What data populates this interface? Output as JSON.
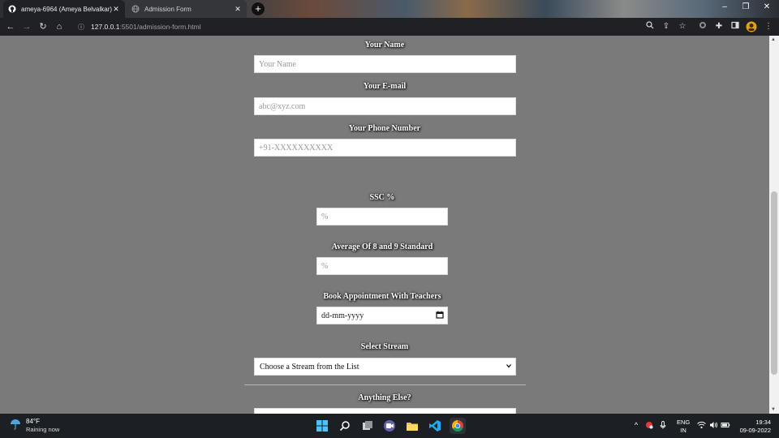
{
  "browser": {
    "tabs": [
      {
        "title": "ameya-6964 (Ameya Belvalkar)",
        "active": true
      },
      {
        "title": "Admission Form",
        "active": false
      }
    ],
    "url_host": "127.0.0.1",
    "url_path": ":5501/admission-form.html"
  },
  "form": {
    "name_label": "Your Name",
    "name_placeholder": "Your Name",
    "email_label": "Your E-mail",
    "email_placeholder": "abc@xyz.com",
    "phone_label": "Your Phone Number",
    "phone_placeholder": "+91-XXXXXXXXXX",
    "ssc_label": "SSC %",
    "ssc_placeholder": "%",
    "avg_label": "Average Of 8 and 9 Standard",
    "avg_placeholder": "%",
    "appointment_label": "Book Appointment With Teachers",
    "appointment_value": "dd-mm-yyyy",
    "stream_label": "Select Stream",
    "stream_selected": "Choose a Stream from the List",
    "anything_label": "Anything Else?"
  },
  "taskbar": {
    "temperature": "84°F",
    "weather": "Raining now",
    "lang_top": "ENG",
    "lang_bottom": "IN",
    "time": "19:34",
    "date": "09-09-2022"
  },
  "icons": [
    "github-icon",
    "globe-icon",
    "close-icon",
    "plus-icon",
    "back-icon",
    "forward-icon",
    "reload-icon",
    "home-icon",
    "info-icon",
    "zoom-icon",
    "share-icon",
    "star-icon",
    "extension-icon",
    "puzzle-icon",
    "sidepanel-icon",
    "profile-icon",
    "menu-icon",
    "calendar-icon",
    "chevron-down-icon",
    "umbrella-icon",
    "windows-icon",
    "search-icon",
    "taskview-icon",
    "teams-icon",
    "folder-icon",
    "vscode-icon",
    "chrome-icon",
    "wifi-icon",
    "volume-icon",
    "battery-icon",
    "microphone-icon"
  ]
}
